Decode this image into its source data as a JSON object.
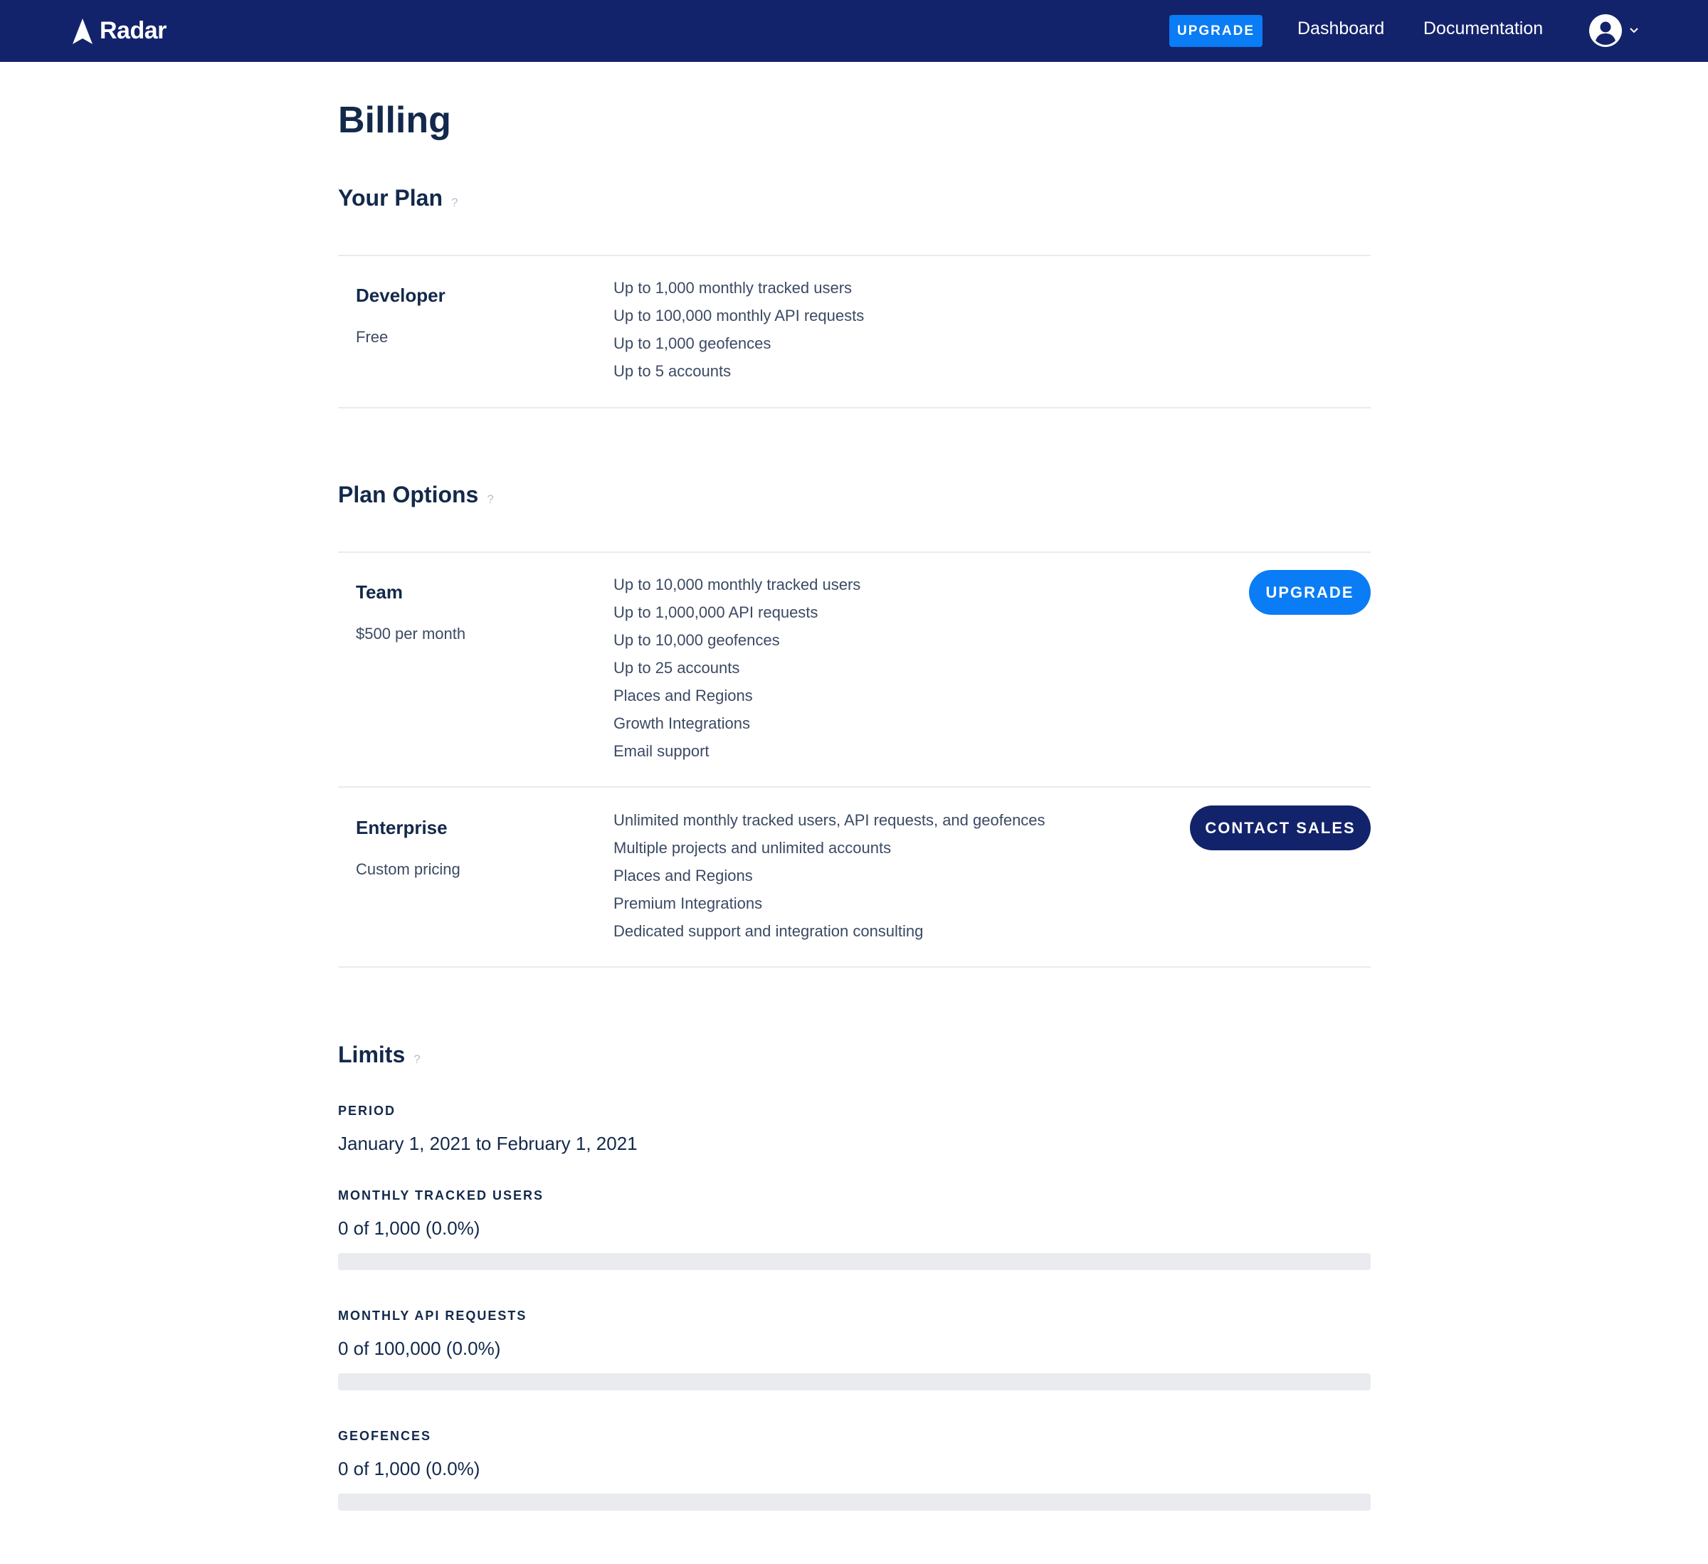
{
  "app": {
    "brand": "Radar"
  },
  "nav": {
    "upgrade_label": "UPGRADE",
    "dashboard_label": "Dashboard",
    "documentation_label": "Documentation"
  },
  "page": {
    "title": "Billing"
  },
  "your_plan": {
    "section_title": "Your Plan",
    "help": "?",
    "name": "Developer",
    "price": "Free",
    "features": [
      "Up to 1,000 monthly tracked users",
      "Up to 100,000 monthly API requests",
      "Up to 1,000 geofences",
      "Up to 5 accounts"
    ]
  },
  "plan_options": {
    "section_title": "Plan Options",
    "help": "?",
    "plans": [
      {
        "name": "Team",
        "price": "$500 per month",
        "button_label": "UPGRADE",
        "features": [
          "Up to 10,000 monthly tracked users",
          "Up to 1,000,000 API requests",
          "Up to 10,000 geofences",
          "Up to 25 accounts",
          "Places and Regions",
          "Growth Integrations",
          "Email support"
        ]
      },
      {
        "name": "Enterprise",
        "price": "Custom pricing",
        "button_label": "CONTACT SALES",
        "features": [
          "Unlimited monthly tracked users, API requests, and geofences",
          "Multiple projects and unlimited accounts",
          "Places and Regions",
          "Premium Integrations",
          "Dedicated support and integration consulting"
        ]
      }
    ]
  },
  "limits": {
    "section_title": "Limits",
    "help": "?",
    "period_label": "PERIOD",
    "period_value": "January 1, 2021 to February 1, 2021",
    "items": [
      {
        "label": "MONTHLY TRACKED USERS",
        "value": "0 of 1,000 (0.0%)",
        "fraction": 0.0
      },
      {
        "label": "MONTHLY API REQUESTS",
        "value": "0 of 100,000 (0.0%)",
        "fraction": 0.0
      },
      {
        "label": "GEOFENCES",
        "value": "0 of 1,000 (0.0%)",
        "fraction": 0.0
      }
    ]
  },
  "colors": {
    "nav_background": "#13236b",
    "accent_blue": "#0a7cf5",
    "heading_text": "#13294b",
    "body_text": "#3b4a63",
    "bar_track": "#e9ebee"
  }
}
